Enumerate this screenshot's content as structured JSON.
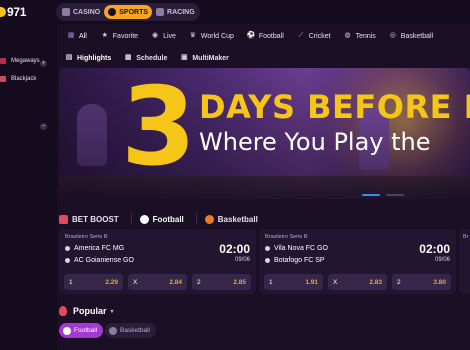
{
  "brand": {
    "logo_text": "971"
  },
  "modes": [
    {
      "label": "CASINO",
      "icon": "casino-icon",
      "active": false
    },
    {
      "label": "SPORTS",
      "icon": "sports-icon",
      "active": true
    },
    {
      "label": "RACING",
      "icon": "racing-icon",
      "active": false
    }
  ],
  "sidebar": {
    "items": [
      {
        "label": "Megaways",
        "icon": "megaways-icon"
      },
      {
        "label": "Blackjack",
        "icon": "blackjack-icon"
      }
    ]
  },
  "categories": [
    {
      "label": "All",
      "icon": "all-icon",
      "glyph": "▦"
    },
    {
      "label": "Favorite",
      "icon": "star-icon",
      "glyph": "★"
    },
    {
      "label": "Live",
      "icon": "live-icon",
      "glyph": "◉"
    },
    {
      "label": "World Cup",
      "icon": "trophy-icon",
      "glyph": "♛"
    },
    {
      "label": "Football",
      "icon": "football-icon",
      "glyph": "⚽"
    },
    {
      "label": "Cricket",
      "icon": "cricket-icon",
      "glyph": "⟋"
    },
    {
      "label": "Tennis",
      "icon": "tennis-icon",
      "glyph": "◍"
    },
    {
      "label": "Basketball",
      "icon": "basketball-icon",
      "glyph": "◎"
    }
  ],
  "subnav": [
    {
      "label": "Highlights",
      "icon": "highlights-icon",
      "glyph": "▤"
    },
    {
      "label": "Schedule",
      "icon": "schedule-icon",
      "glyph": "▦"
    },
    {
      "label": "MultiMaker",
      "icon": "multimaker-icon",
      "glyph": "▣"
    }
  ],
  "banner": {
    "number": "3",
    "line1": "DAYS BEFORE I",
    "line2": "Where You Play the"
  },
  "sport_tabs": [
    {
      "label": "BET BOOST",
      "icon": "rocket-icon"
    },
    {
      "label": "Football",
      "icon": "football-icon"
    },
    {
      "label": "Basketball",
      "icon": "basketball-icon"
    }
  ],
  "matches": [
    {
      "league": "Brasileiro Serie B",
      "home": "America FC MG",
      "away": "AC Goianiense GO",
      "time": "02:00",
      "date": "09/06",
      "odds": [
        {
          "label": "1",
          "value": "2.29"
        },
        {
          "label": "X",
          "value": "2.84"
        },
        {
          "label": "2",
          "value": "2.85"
        }
      ]
    },
    {
      "league": "Brasileiro Serie B",
      "home": "Vila Nova FC GO",
      "away": "Botafogo FC SP",
      "time": "02:00",
      "date": "09/06",
      "odds": [
        {
          "label": "1",
          "value": "1.91"
        },
        {
          "label": "X",
          "value": "2.83"
        },
        {
          "label": "2",
          "value": "3.80"
        }
      ]
    },
    {
      "league": "Br",
      "home": "",
      "away": "",
      "time": "",
      "date": "",
      "odds": []
    }
  ],
  "popular": {
    "title": "Popular",
    "chips": [
      {
        "label": "Football",
        "icon": "football-icon",
        "active": true
      },
      {
        "label": "Basketball",
        "icon": "basketball-icon",
        "active": false
      }
    ]
  },
  "colors": {
    "background": "#1a0f24",
    "accent": "#f5a524",
    "banner_yellow": "#f5c518",
    "chip_active": "#a537d6",
    "slider_active": "#2e93e8"
  }
}
